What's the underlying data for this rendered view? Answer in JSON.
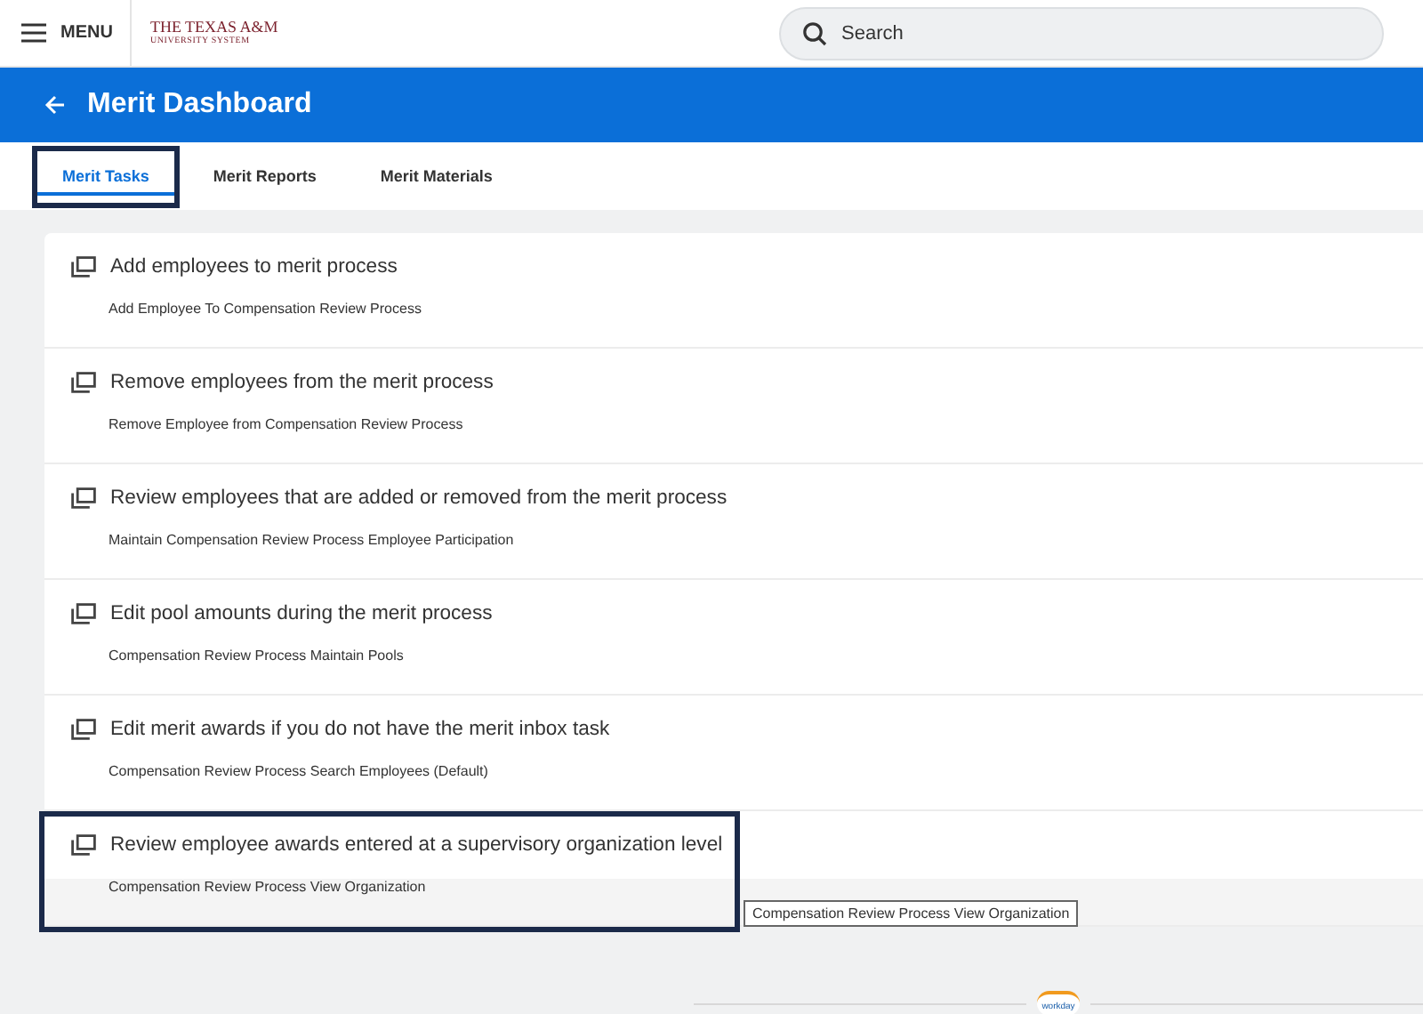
{
  "header": {
    "menu_label": "MENU",
    "logo_lines": [
      "THE TEXAS A&M",
      "UNIVERSITY SYSTEM"
    ],
    "search": {
      "placeholder": "Search"
    }
  },
  "page_title": "Merit Dashboard",
  "tabs": [
    {
      "label": "Merit Tasks",
      "selected": true,
      "highlighted": true
    },
    {
      "label": "Merit Reports",
      "selected": false,
      "highlighted": false
    },
    {
      "label": "Merit Materials",
      "selected": false,
      "highlighted": false
    }
  ],
  "tasks": [
    {
      "title": "Add employees to merit process",
      "subtitle": "Add Employee To Compensation Review Process",
      "hovered": false,
      "highlighted": false
    },
    {
      "title": "Remove employees from the merit process",
      "subtitle": "Remove Employee from Compensation Review Process",
      "hovered": false,
      "highlighted": false
    },
    {
      "title": "Review employees that are added or removed from the merit process",
      "subtitle": "Maintain Compensation Review Process Employee Participation",
      "hovered": false,
      "highlighted": false
    },
    {
      "title": "Edit pool amounts during the merit process",
      "subtitle": "Compensation Review Process Maintain Pools",
      "hovered": false,
      "highlighted": false
    },
    {
      "title": "Edit merit awards if you do not have the merit inbox task",
      "subtitle": "Compensation Review Process Search Employees (Default)",
      "hovered": false,
      "highlighted": false
    },
    {
      "title": "Review employee awards entered at a supervisory organization level",
      "subtitle": "Compensation Review Process View Organization",
      "hovered": true,
      "highlighted": true,
      "tooltip": "Compensation Review Process View Organization"
    }
  ],
  "footer": {
    "logo": "workday"
  }
}
